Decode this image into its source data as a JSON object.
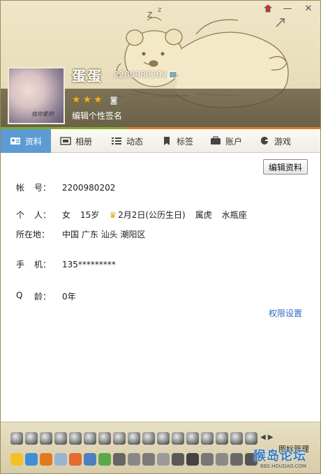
{
  "profile": {
    "nickname": "蛋蛋",
    "qq_number": "2200980202",
    "signature": "编辑个性签名",
    "avatar_text": "找你爱的"
  },
  "window_controls": {
    "skin_icon": "skin-icon",
    "minimize": "—",
    "close": "✕"
  },
  "tabs": [
    {
      "label": "资料",
      "icon": "profile-card-icon",
      "active": true
    },
    {
      "label": "相册",
      "icon": "photo-album-icon",
      "active": false
    },
    {
      "label": "动态",
      "icon": "list-icon",
      "active": false
    },
    {
      "label": "标签",
      "icon": "bookmark-icon",
      "active": false
    },
    {
      "label": "账户",
      "icon": "wallet-icon",
      "active": false
    },
    {
      "label": "游戏",
      "icon": "game-icon",
      "active": false
    }
  ],
  "edit_button": "编辑资料",
  "info": {
    "account_label_1": "帐",
    "account_label_2": "号：",
    "account_value": "2200980202",
    "person_label_1": "个",
    "person_label_2": "人：",
    "gender": "女",
    "age": "15岁",
    "birthday": "2月2日(公历生日)",
    "zodiac": "属虎",
    "constellation": "水瓶座",
    "location_label": "所在地：",
    "location_value": "中国 广东 汕头 潮阳区",
    "phone_label_1": "手",
    "phone_label_2": "机：",
    "phone_value": "135*********",
    "qage_label_1": "Q",
    "qage_label_2": "龄：",
    "qage_value": "0年"
  },
  "permission_link": "权限设置",
  "iconbar": {
    "manage_label": "图标管理",
    "watermark": "猴岛论坛",
    "watermark_sub": "BBS.HOUDAO.COM"
  },
  "colors": {
    "tab_active": "#5c9bd4",
    "link": "#2a69c1",
    "star": "#f2b21a",
    "line_green": "#7caa2c",
    "line_orange": "#d9792d"
  }
}
